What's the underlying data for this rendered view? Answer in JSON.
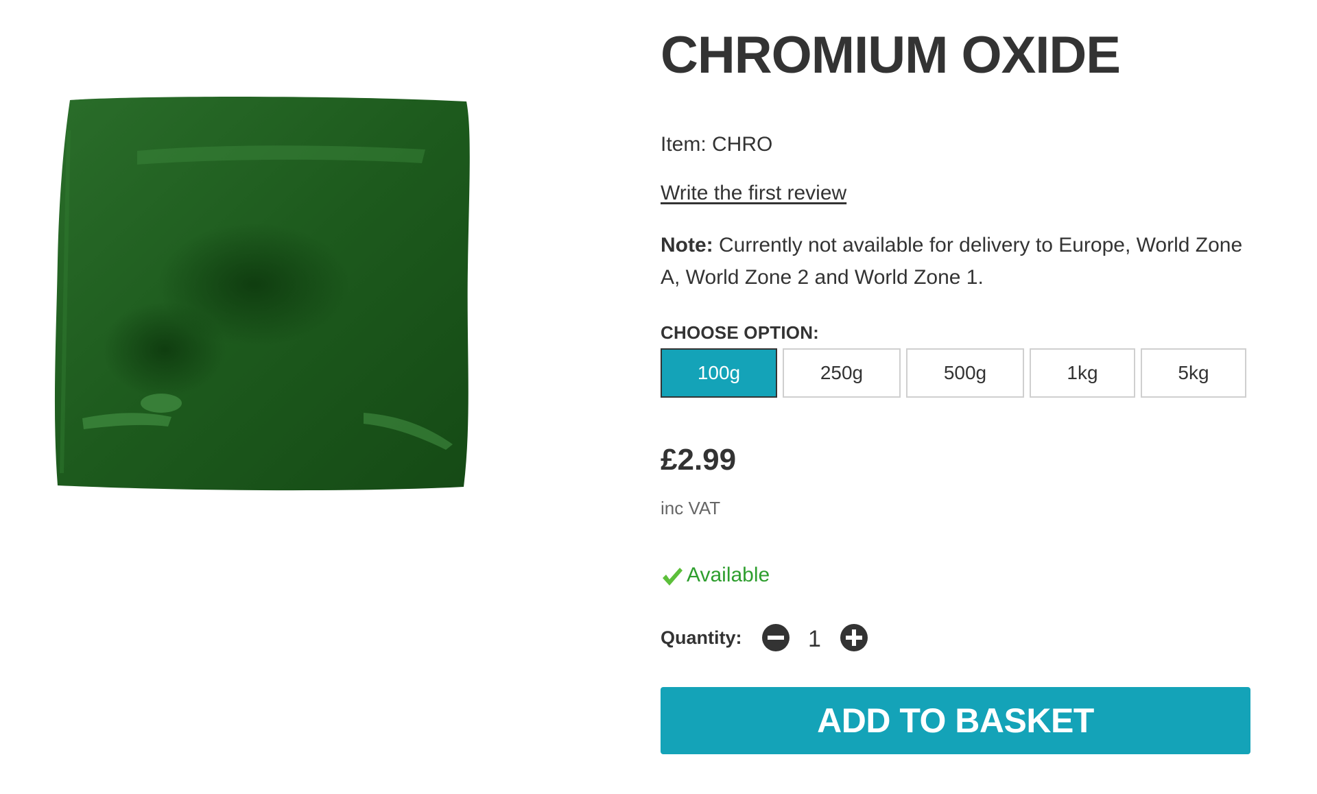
{
  "product": {
    "title": "CHROMIUM OXIDE",
    "item_code": "Item: CHRO",
    "review_link": "Write the first review",
    "note_label": "Note:",
    "note_text": " Currently not available for delivery to Europe, World Zone A, World Zone 2 and World Zone 1.",
    "swatch_color": "#1f5f1f"
  },
  "options": {
    "label": "CHOOSE OPTION:",
    "items": [
      "100g",
      "250g",
      "500g",
      "1kg",
      "5kg"
    ],
    "selected": "100g",
    "selected_color": "#14a3b8"
  },
  "pricing": {
    "price": "£2.99",
    "vat_note": "inc VAT"
  },
  "availability": {
    "icon": "checkmark-icon",
    "text": "Available",
    "color": "#2e9e2e"
  },
  "quantity": {
    "label": "Quantity:",
    "value": "1",
    "decrement_icon": "minus-circle-icon",
    "increment_icon": "plus-circle-icon"
  },
  "cta": {
    "label": "ADD TO BASKET",
    "color": "#14a3b8"
  }
}
